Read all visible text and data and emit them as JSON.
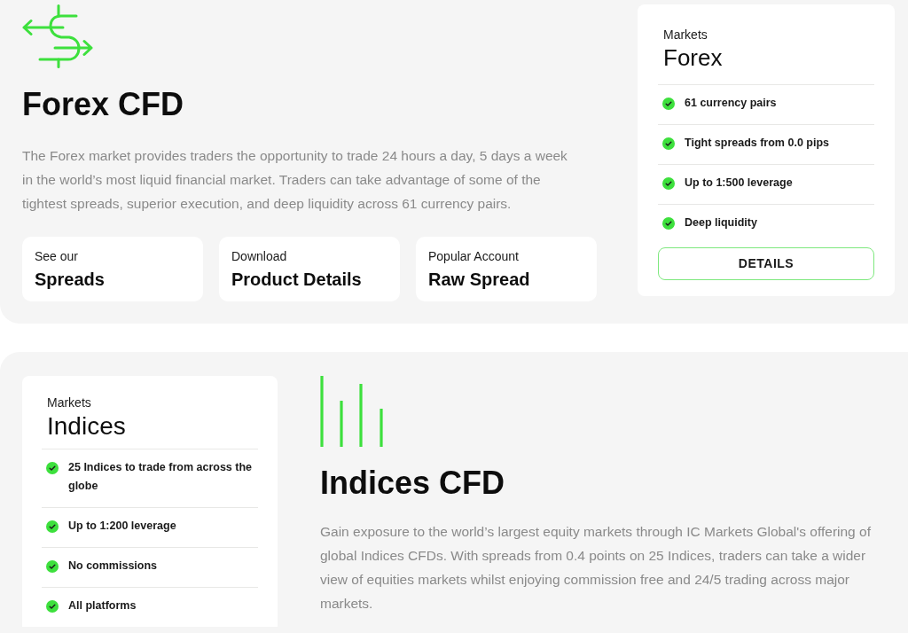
{
  "forex_section": {
    "title": "Forex CFD",
    "description": "The Forex market provides traders the opportunity to trade 24 hours a day, 5 days a week in the world’s most liquid financial market. Traders can take advantage of some of the tightest spreads, superior execution, and deep liquidity across 61 currency pairs.",
    "links": [
      {
        "label": "See our",
        "title": "Spreads"
      },
      {
        "label": "Download",
        "title": "Product Details"
      },
      {
        "label": "Popular Account",
        "title": "Raw Spread"
      }
    ],
    "market_card": {
      "eyebrow": "Markets",
      "title": "Forex",
      "features": [
        "61 currency pairs",
        "Tight spreads from 0.0 pips",
        "Up to 1:500 leverage",
        "Deep liquidity"
      ],
      "button": "DETAILS"
    }
  },
  "indices_section": {
    "market_card": {
      "eyebrow": "Markets",
      "title": "Indices",
      "features": [
        "25 Indices to trade from across the globe",
        "Up to 1:200 leverage",
        "No commissions",
        "All platforms"
      ]
    },
    "title": "Indices CFD",
    "description": "Gain exposure to the world’s largest equity markets through IC Markets Global's offering of global Indices CFDs. With spreads from 0.4 points on 25 Indices, traders can take a wider view of equities markets whilst enjoying commission free and 24/5 trading across major markets."
  }
}
